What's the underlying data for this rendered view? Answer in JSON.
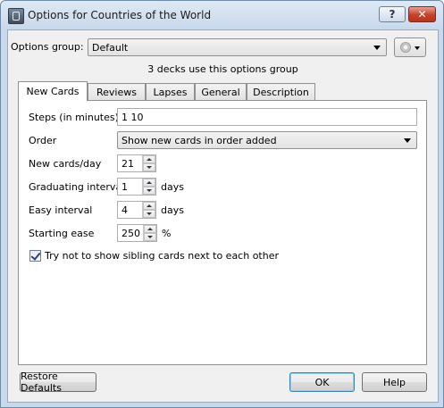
{
  "window": {
    "title": "Options for Countries of the World",
    "help_glyph": "?",
    "close_glyph": "✕"
  },
  "options_group": {
    "label": "Options group:",
    "value": "Default",
    "decks_info": "3 decks use this options group"
  },
  "tabs": [
    {
      "label": "New Cards",
      "active": true
    },
    {
      "label": "Reviews"
    },
    {
      "label": "Lapses"
    },
    {
      "label": "General"
    },
    {
      "label": "Description"
    }
  ],
  "new_cards": {
    "steps": {
      "label": "Steps (in minutes)",
      "value": "1 10"
    },
    "order": {
      "label": "Order",
      "value": "Show new cards in order added"
    },
    "per_day": {
      "label": "New cards/day",
      "value": "21"
    },
    "graduating": {
      "label": "Graduating interval",
      "value": "1",
      "unit": "days"
    },
    "easy": {
      "label": "Easy interval",
      "value": "4",
      "unit": "days"
    },
    "starting_ease": {
      "label": "Starting ease",
      "value": "250",
      "unit": "%"
    },
    "sibling": {
      "label": "Try not to show sibling cards next to each other",
      "checked": true
    }
  },
  "buttons": {
    "restore": "Restore Defaults",
    "ok": "OK",
    "help": "Help"
  }
}
